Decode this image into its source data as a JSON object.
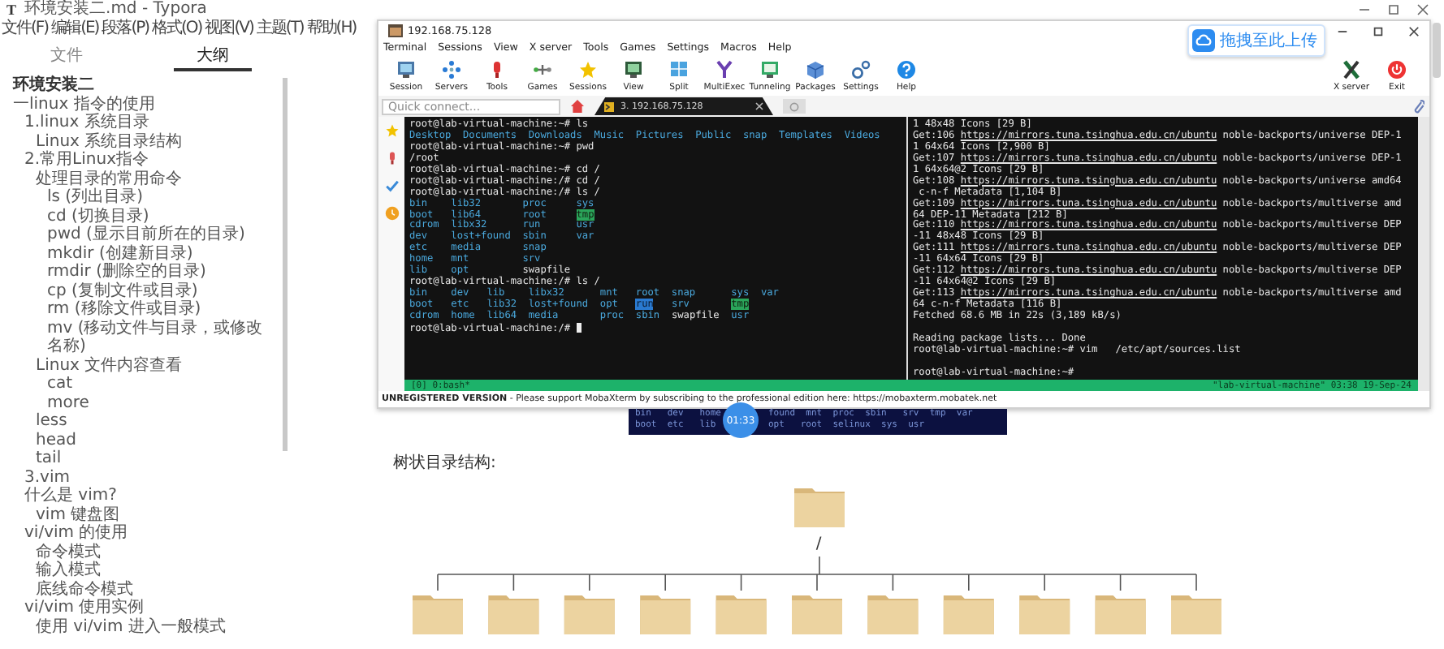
{
  "window": {
    "icon": "T",
    "title": "环境安装二.md - Typora"
  },
  "menu": [
    "文件(F)",
    "编辑(E)",
    "段落(P)",
    "格式(O)",
    "视图(V)",
    "主题(T)",
    "帮助(H)"
  ],
  "sidebar": {
    "tabs": [
      {
        "label": "文件",
        "selected": false
      },
      {
        "label": "大纲",
        "selected": true
      }
    ],
    "outline_heading": "环境安装二",
    "outline": [
      {
        "text": "一linux 指令的使用",
        "children": [
          {
            "text": "1.linux 系统目录",
            "children": [
              {
                "text": "Linux 系统目录结构"
              }
            ]
          },
          {
            "text": "2.常用Linux指令",
            "children": [
              {
                "text": "处理目录的常用命令",
                "children": [
                  {
                    "text": "ls (列出目录)"
                  },
                  {
                    "text": "cd (切换目录)"
                  },
                  {
                    "text": "pwd (显示目前所在的目录)"
                  },
                  {
                    "text": "mkdir (创建新目录)"
                  },
                  {
                    "text": "rmdir (删除空的目录)"
                  },
                  {
                    "text": "cp (复制文件或目录)"
                  },
                  {
                    "text": "rm (移除文件或目录)"
                  },
                  {
                    "text": "mv (移动文件与目录，或修改名称)"
                  }
                ]
              },
              {
                "text": "Linux 文件内容查看",
                "children": [
                  {
                    "text": "cat"
                  },
                  {
                    "text": "more"
                  }
                ]
              },
              {
                "text": "less"
              },
              {
                "text": "head"
              },
              {
                "text": "tail"
              }
            ]
          },
          {
            "text": "3.vim"
          },
          {
            "text": "什么是 vim?",
            "children": [
              {
                "text": "vim 键盘图"
              }
            ]
          },
          {
            "text": "vi/vim 的使用",
            "children": [
              {
                "text": "命令模式"
              },
              {
                "text": "输入模式"
              },
              {
                "text": "底线命令模式"
              }
            ]
          },
          {
            "text": "vi/vim 使用实例",
            "children": [
              {
                "text": "使用 vi/vim 进入一般模式"
              }
            ]
          }
        ]
      }
    ]
  },
  "document": {
    "screenshot": {
      "title": "192.168.75.128",
      "menu": [
        "Terminal",
        "Sessions",
        "View",
        "X server",
        "Tools",
        "Games",
        "Settings",
        "Macros",
        "Help"
      ],
      "toolbar": [
        {
          "label": "Session",
          "kind": "session"
        },
        {
          "label": "Servers",
          "kind": "servers"
        },
        {
          "label": "Tools",
          "kind": "tools"
        },
        {
          "label": "Games",
          "kind": "games"
        },
        {
          "label": "Sessions",
          "kind": "sessions"
        },
        {
          "label": "View",
          "kind": "view"
        },
        {
          "label": "Split",
          "kind": "split"
        },
        {
          "label": "MultiExec",
          "kind": "multiexec"
        },
        {
          "label": "Tunneling",
          "kind": "tunneling"
        },
        {
          "label": "Packages",
          "kind": "packages"
        },
        {
          "label": "Settings",
          "kind": "settings"
        },
        {
          "label": "Help",
          "kind": "help"
        }
      ],
      "toolbar_right": [
        {
          "label": "X server",
          "kind": "xserver"
        },
        {
          "label": "Exit",
          "kind": "exit"
        }
      ],
      "upload_badge": "拖拽至此上传",
      "quick_connect": {
        "placeholder": "Quick connect..."
      },
      "tabs": [
        {
          "label": "3. 192.168.75.128",
          "selected": true
        }
      ],
      "left_pane": {
        "lines": [
          {
            "segments": [
              {
                "kind": "plain",
                "text": "root@lab-virtual-machine:~# ls"
              }
            ]
          },
          {
            "segments": [
              {
                "kind": "dir",
                "text": "Desktop  Documents  Downloads  Music  Pictures  Public  snap  Templates  Videos"
              }
            ]
          },
          {
            "segments": [
              {
                "kind": "plain",
                "text": "root@lab-virtual-machine:~# pwd"
              }
            ]
          },
          {
            "segments": [
              {
                "kind": "plain",
                "text": "/root"
              }
            ]
          },
          {
            "segments": [
              {
                "kind": "plain",
                "text": "root@lab-virtual-machine:~# cd /"
              }
            ]
          },
          {
            "segments": [
              {
                "kind": "plain",
                "text": "root@lab-virtual-machine:/# cd /"
              }
            ]
          },
          {
            "segments": [
              {
                "kind": "plain",
                "text": "root@lab-virtual-machine:/# ls /"
              }
            ]
          },
          {
            "segments": [
              {
                "kind": "dir",
                "text": "bin    lib32       proc     sys"
              }
            ]
          },
          {
            "segments": [
              {
                "kind": "dir",
                "text": "boot   lib64       root     "
              },
              {
                "kind": "sticky",
                "text": "tmp"
              }
            ]
          },
          {
            "segments": [
              {
                "kind": "dir",
                "text": "cdrom  libx32      run      usr"
              }
            ]
          },
          {
            "segments": [
              {
                "kind": "dir",
                "text": "dev    lost+found  sbin     var"
              }
            ]
          },
          {
            "segments": [
              {
                "kind": "dir",
                "text": "etc    media       snap"
              }
            ]
          },
          {
            "segments": [
              {
                "kind": "dir",
                "text": "home   mnt         srv"
              }
            ]
          },
          {
            "segments": [
              {
                "kind": "dir",
                "text": "lib    opt         "
              },
              {
                "kind": "plain",
                "text": "swapfile"
              }
            ]
          },
          {
            "segments": [
              {
                "kind": "plain",
                "text": "root@lab-virtual-machine:/# ls /"
              }
            ]
          },
          {
            "segments": [
              {
                "kind": "dir",
                "text": "bin    dev   lib    libx32      mnt   root  snap      sys  var"
              }
            ]
          },
          {
            "segments": [
              {
                "kind": "dir",
                "text": "boot   etc   lib32  lost+found  opt   "
              },
              {
                "kind": "dirhl",
                "text": "run"
              },
              {
                "kind": "dir",
                "text": "   srv       "
              },
              {
                "kind": "sticky",
                "text": "tmp"
              }
            ]
          },
          {
            "segments": [
              {
                "kind": "dir",
                "text": "cdrom  home  lib64  media       proc  sbin  "
              },
              {
                "kind": "plain",
                "text": "swapfile"
              },
              {
                "kind": "dir",
                "text": "  usr"
              }
            ]
          },
          {
            "segments": [
              {
                "kind": "plain",
                "text": "root@lab-virtual-machine:/# "
              }
            ],
            "cursor": true
          }
        ]
      },
      "right_pane": {
        "lines": [
          {
            "segments": [
              {
                "kind": "plain",
                "text": "1 48x48 Icons [29 B]"
              }
            ]
          },
          {
            "segments": [
              {
                "kind": "plain",
                "text": "Get:106 "
              },
              {
                "kind": "link",
                "text": "https://mirrors.tuna.tsinghua.edu.cn/ubuntu"
              },
              {
                "kind": "plain",
                "text": " noble-backports/universe DEP-1"
              }
            ]
          },
          {
            "segments": [
              {
                "kind": "plain",
                "text": "1 64x64 Icons [2,900 B]"
              }
            ]
          },
          {
            "segments": [
              {
                "kind": "plain",
                "text": "Get:107 "
              },
              {
                "kind": "link",
                "text": "https://mirrors.tuna.tsinghua.edu.cn/ubuntu"
              },
              {
                "kind": "plain",
                "text": " noble-backports/universe DEP-1"
              }
            ]
          },
          {
            "segments": [
              {
                "kind": "plain",
                "text": "1 64x64@2 Icons [29 B]"
              }
            ]
          },
          {
            "segments": [
              {
                "kind": "plain",
                "text": "Get:108 "
              },
              {
                "kind": "link",
                "text": "https://mirrors.tuna.tsinghua.edu.cn/ubuntu"
              },
              {
                "kind": "plain",
                "text": " noble-backports/universe amd64"
              }
            ]
          },
          {
            "segments": [
              {
                "kind": "plain",
                "text": " c-n-f Metadata [1,104 B]"
              }
            ]
          },
          {
            "segments": [
              {
                "kind": "plain",
                "text": "Get:109 "
              },
              {
                "kind": "link",
                "text": "https://mirrors.tuna.tsinghua.edu.cn/ubuntu"
              },
              {
                "kind": "plain",
                "text": " noble-backports/multiverse amd"
              }
            ]
          },
          {
            "segments": [
              {
                "kind": "plain",
                "text": "64 DEP-11 Metadata [212 B]"
              }
            ]
          },
          {
            "segments": [
              {
                "kind": "plain",
                "text": "Get:110 "
              },
              {
                "kind": "link",
                "text": "https://mirrors.tuna.tsinghua.edu.cn/ubuntu"
              },
              {
                "kind": "plain",
                "text": " noble-backports/multiverse DEP"
              }
            ]
          },
          {
            "segments": [
              {
                "kind": "plain",
                "text": "-11 48x48 Icons [29 B]"
              }
            ]
          },
          {
            "segments": [
              {
                "kind": "plain",
                "text": "Get:111 "
              },
              {
                "kind": "link",
                "text": "https://mirrors.tuna.tsinghua.edu.cn/ubuntu"
              },
              {
                "kind": "plain",
                "text": " noble-backports/multiverse DEP"
              }
            ]
          },
          {
            "segments": [
              {
                "kind": "plain",
                "text": "-11 64x64 Icons [29 B]"
              }
            ]
          },
          {
            "segments": [
              {
                "kind": "plain",
                "text": "Get:112 "
              },
              {
                "kind": "link",
                "text": "https://mirrors.tuna.tsinghua.edu.cn/ubuntu"
              },
              {
                "kind": "plain",
                "text": " noble-backports/multiverse DEP"
              }
            ]
          },
          {
            "segments": [
              {
                "kind": "plain",
                "text": "-11 64x64@2 Icons [29 B]"
              }
            ]
          },
          {
            "segments": [
              {
                "kind": "plain",
                "text": "Get:113 "
              },
              {
                "kind": "link",
                "text": "https://mirrors.tuna.tsinghua.edu.cn/ubuntu"
              },
              {
                "kind": "plain",
                "text": " noble-backports/multiverse amd"
              }
            ]
          },
          {
            "segments": [
              {
                "kind": "plain",
                "text": "64 c-n-f Metadata [116 B]"
              }
            ]
          },
          {
            "segments": [
              {
                "kind": "plain",
                "text": "Fetched 68.6 MB in 22s (3,189 kB/s)"
              }
            ]
          },
          {
            "segments": [
              {
                "kind": "plain",
                "text": "Reading package lists... Done"
              }
            ],
            "gap_before": true
          },
          {
            "segments": [
              {
                "kind": "plain",
                "text": "root@lab-virtual-machine:~# vim   /etc/apt/sources.list"
              }
            ]
          },
          {
            "segments": [
              {
                "kind": "plain",
                "text": "root@lab-virtual-machine:~#"
              }
            ],
            "gap_before": true
          }
        ]
      },
      "status_left": "[0] 0:bash*",
      "status_right": "\"lab-virtual-machine\" 03:38 19-Sep-24",
      "notice": {
        "text": "**UNREGISTERED VERSION** - Please support MobaXterm by subscribing to the professional edition here: ",
        "link": "https://mobaxterm.mobatek.net"
      }
    },
    "clip": {
      "rows": [
        [
          "bin   dev   home",
          "found  mnt  proc  sbin   srv  tmp  var"
        ],
        [
          "boot  etc   lib",
          "opt   root  selinux  sys  usr"
        ]
      ],
      "timer": "01:33"
    },
    "heading": "树状目录结构:",
    "tree": {
      "root_label": "/",
      "children": [
        {
          "kind": "folder"
        },
        {
          "kind": "folder"
        },
        {
          "kind": "folder"
        },
        {
          "kind": "folder"
        },
        {
          "kind": "folder"
        },
        {
          "kind": "folder"
        },
        {
          "kind": "folder"
        },
        {
          "kind": "folder"
        },
        {
          "kind": "folder"
        },
        {
          "kind": "folder"
        },
        {
          "kind": "folder"
        }
      ]
    }
  }
}
